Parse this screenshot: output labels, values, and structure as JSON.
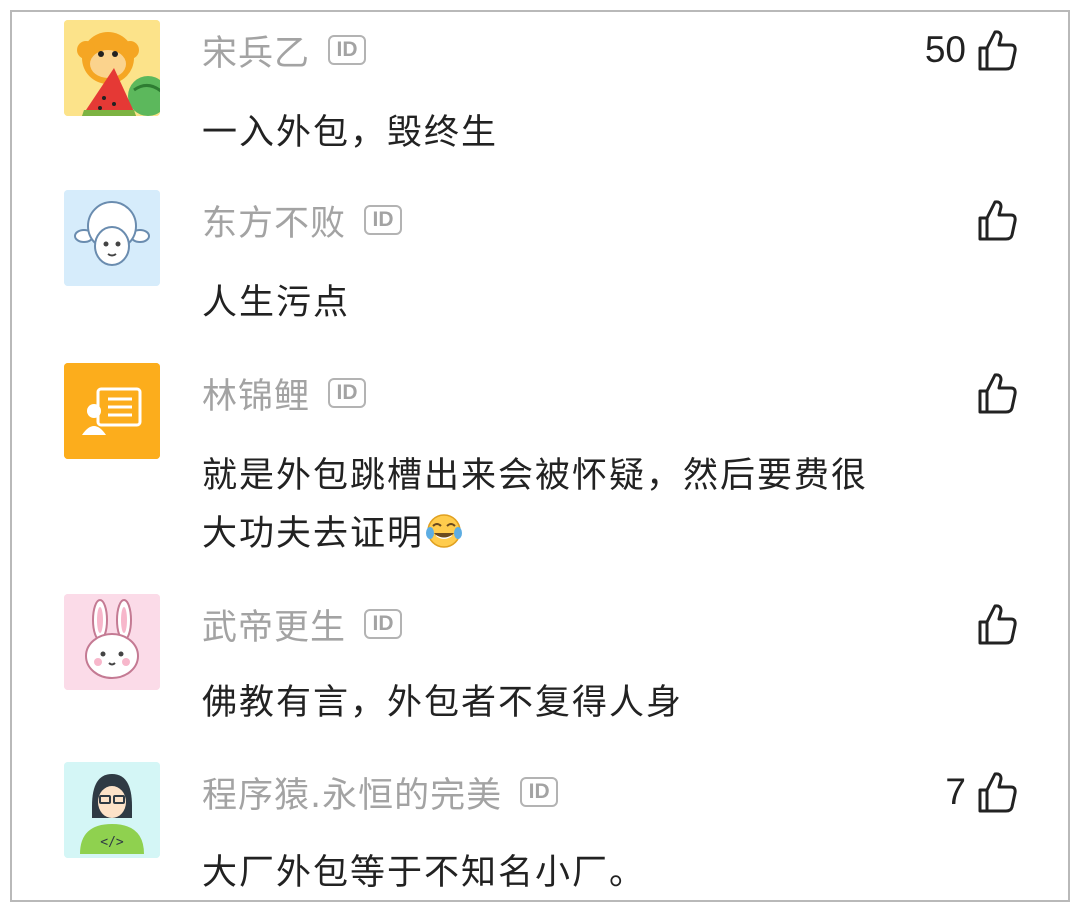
{
  "comments": [
    {
      "username": "宋兵乙",
      "id_badge": "ID",
      "lines": [
        "一入外包，毁终生"
      ],
      "likes": "50",
      "avatar_icon": "monkey-watermelon-icon"
    },
    {
      "username": "东方不败",
      "id_badge": "ID",
      "lines": [
        "人生污点"
      ],
      "likes": "",
      "avatar_icon": "sheep-icon"
    },
    {
      "username": "林锦鲤",
      "id_badge": "ID",
      "lines": [
        "就是外包跳槽出来会被怀疑，然后要费很",
        "大功夫去证明"
      ],
      "likes": "",
      "avatar_icon": "id-card-icon"
    },
    {
      "username": "武帝更生",
      "id_badge": "ID",
      "lines": [
        "佛教有言，外包者不复得人身"
      ],
      "likes": "",
      "avatar_icon": "rabbit-icon"
    },
    {
      "username": "程序猿.永恒的完美",
      "id_badge": "ID",
      "lines": [
        "大厂外包等于不知名小厂。"
      ],
      "likes": "7",
      "avatar_icon": "programmer-icon"
    }
  ],
  "colors": {
    "username": "#a3a3a3",
    "text": "#222222",
    "border": "#b9b9b9"
  }
}
